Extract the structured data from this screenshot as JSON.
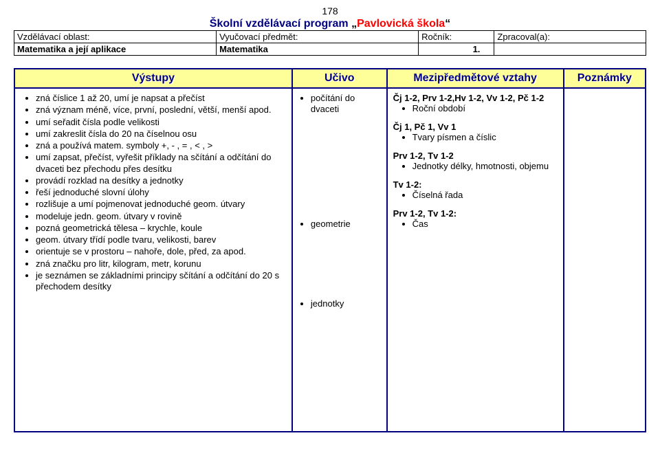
{
  "page_number": "178",
  "title": {
    "program": "Školní vzdělávací program",
    "quote_open": "„",
    "school": "Pavlovická škola",
    "quote_close": "“"
  },
  "header": {
    "r1c1": "Vzdělávací oblast:",
    "r1c2": "Vyučovací předmět:",
    "r1c3": "Ročník:",
    "r1c4": "Zpracoval(a):",
    "r2c1": "Matematika a její aplikace",
    "r2c2": "Matematika",
    "r2c3": "1.",
    "r2c4": ""
  },
  "columns": {
    "c1": "Výstupy",
    "c2": "Učivo",
    "c3": "Mezipředmětové vztahy",
    "c4": "Poznámky"
  },
  "vystupy": [
    "zná číslice 1 až 20, umí je napsat a přečíst",
    "zná význam méně, více, první, poslední, větší, menší apod.",
    "umí seřadit čísla podle velikosti",
    "umí zakreslit čísla do 20 na číselnou osu",
    "zná a používá matem. symboly +, - , = , < , >",
    "umí zapsat, přečíst, vyřešit příklady na sčítání a odčítání do dvaceti bez přechodu přes desítku",
    "provádí rozklad na desítky a jednotky",
    "řeší jednoduché slovní úlohy",
    "rozlišuje a umí pojmenovat jednoduché geom. útvary",
    "modeluje jedn. geom. útvary v rovině",
    "pozná geometrická tělesa – krychle, koule",
    "geom. útvary třídí podle tvaru, velikosti, barev",
    "orientuje se v prostoru – nahoře, dole, před, za apod.",
    "zná značku pro litr, kilogram, metr, korunu",
    "je seznámen se základními principy sčítání a odčítání do 20 s přechodem desítky"
  ],
  "ucivo": [
    "počítání do dvaceti",
    "geometrie",
    "jednotky"
  ],
  "ucivo_gap1": "150px",
  "ucivo_gap2": "100px",
  "relations": [
    {
      "head": "Čj 1-2, Prv 1-2,Hv 1-2, Vv 1-2, Pč 1-2",
      "items": [
        "Roční období"
      ]
    },
    {
      "head": "Čj 1, Pč 1, Vv 1",
      "items": [
        "Tvary písmen a číslic"
      ]
    },
    {
      "head": "Prv 1-2, Tv 1-2",
      "items": [
        "Jednotky délky, hmotnosti, objemu"
      ]
    },
    {
      "head": "Tv 1-2:",
      "items": [
        "Číselná řada"
      ]
    },
    {
      "head": "Prv 1-2, Tv 1-2:",
      "items": [
        "Čas"
      ]
    }
  ]
}
